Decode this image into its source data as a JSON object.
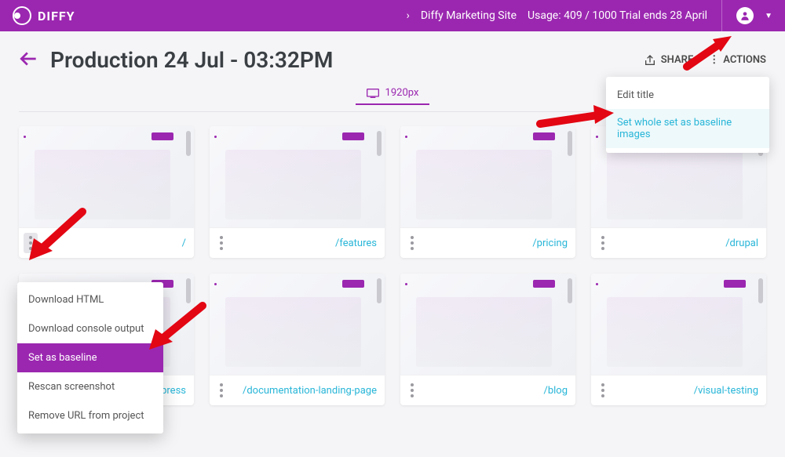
{
  "topbar": {
    "brand": "DIFFY",
    "project": "Diffy Marketing Site",
    "usage": "Usage: 409 / 1000 Trial ends 28 April"
  },
  "page": {
    "title": "Production 24 Jul - 03:32PM",
    "share": "SHARE",
    "actions": "ACTIONS",
    "breakpoint": "1920px"
  },
  "actionsMenu": {
    "editTitle": "Edit title",
    "setBaseline": "Set whole set as baseline images"
  },
  "contextMenu": {
    "downloadHtml": "Download HTML",
    "downloadConsole": "Download console output",
    "setBaseline": "Set as baseline",
    "rescan": "Rescan screenshot",
    "removeUrl": "Remove URL from project"
  },
  "cards": [
    {
      "url": "/"
    },
    {
      "url": "/features"
    },
    {
      "url": "/pricing"
    },
    {
      "url": "/drupal"
    },
    {
      "url": "/wordpress"
    },
    {
      "url": "/documentation-landing-page"
    },
    {
      "url": "/blog"
    },
    {
      "url": "/visual-testing"
    }
  ]
}
